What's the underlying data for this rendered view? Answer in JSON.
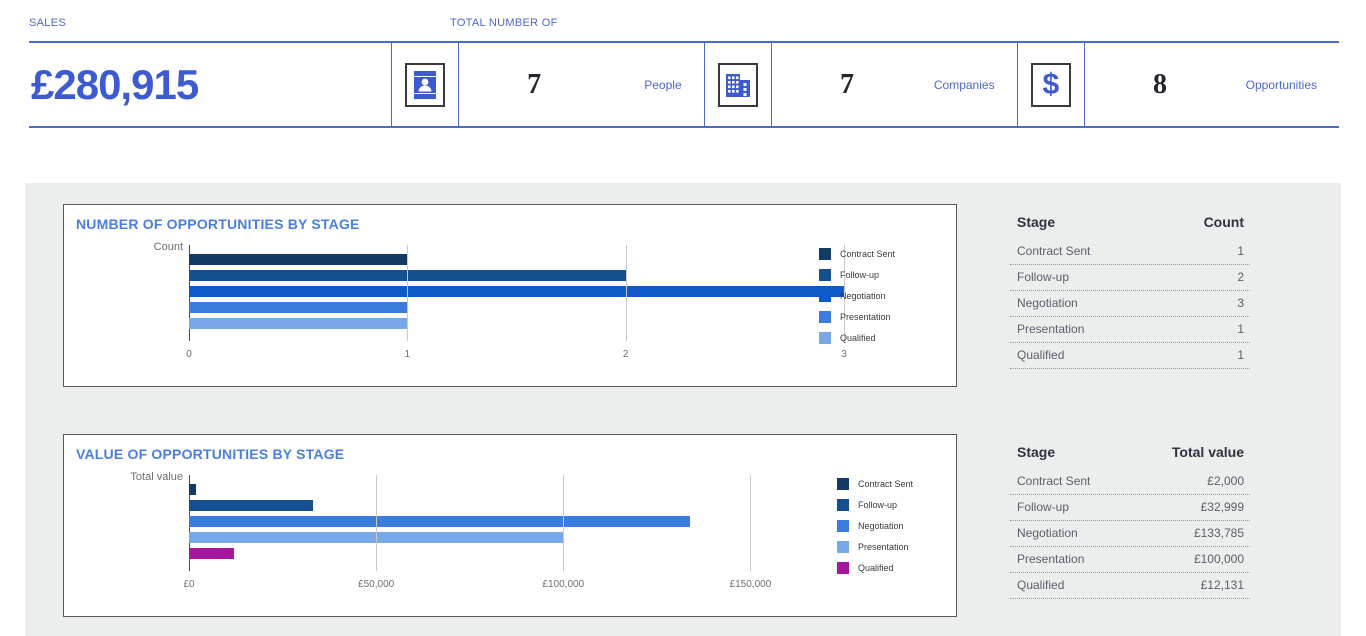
{
  "header": {
    "sales_caption": "SALES",
    "total_number_caption": "TOTAL NUMBER OF",
    "sales_value": "£280,915",
    "accent_color": "#3d5ad0",
    "caption_color": "#4d68c9",
    "metrics": [
      {
        "icon": "contact-card-icon",
        "value": "7",
        "label": "People"
      },
      {
        "icon": "building-icon",
        "value": "7",
        "label": "Companies"
      },
      {
        "icon": "dollar-icon",
        "value": "8",
        "label": "Opportunities"
      }
    ]
  },
  "charts": [
    {
      "title": "NUMBER OF OPPORTUNITIES BY STAGE",
      "axis_label": "Count",
      "table": {
        "col_stage": "Stage",
        "col_value": "Count"
      }
    },
    {
      "title": "VALUE OF OPPORTUNITIES BY STAGE",
      "axis_label": "Total value",
      "table": {
        "col_stage": "Stage",
        "col_value": "Total value"
      }
    }
  ],
  "chart_data": [
    {
      "type": "bar",
      "orientation": "horizontal",
      "title": "NUMBER OF OPPORTUNITIES BY STAGE",
      "xlabel": "",
      "ylabel": "Count",
      "categories": [
        "Contract Sent",
        "Follow-up",
        "Negotiation",
        "Presentation",
        "Qualified"
      ],
      "values": [
        1,
        2,
        3,
        1,
        1
      ],
      "value_labels": [
        "1",
        "2",
        "3",
        "1",
        "1"
      ],
      "colors": [
        "#113a64",
        "#14508f",
        "#1059c9",
        "#3b7ddd",
        "#78a7ea"
      ],
      "xlim": [
        0,
        3
      ],
      "xticks": [
        0,
        1,
        2,
        3
      ],
      "xticklabels": [
        "0",
        "1",
        "2",
        "3"
      ],
      "grid": true,
      "legend": [
        "Contract Sent",
        "Follow-up",
        "Negotiation",
        "Presentation",
        "Qualified"
      ],
      "legend_position": "right"
    },
    {
      "type": "bar",
      "orientation": "horizontal",
      "title": "VALUE OF OPPORTUNITIES BY STAGE",
      "xlabel": "",
      "ylabel": "Total value",
      "categories": [
        "Contract Sent",
        "Follow-up",
        "Negotiation",
        "Presentation",
        "Qualified"
      ],
      "values": [
        2000,
        32999,
        133785,
        100000,
        12131
      ],
      "value_labels": [
        "£2,000",
        "£32,999",
        "£133,785",
        "£100,000",
        "£12,131"
      ],
      "colors": [
        "#113a64",
        "#14508f",
        "#3b7ddd",
        "#78a7ea",
        "#a5169c"
      ],
      "xlim": [
        0,
        175000
      ],
      "xticks": [
        0,
        50000,
        100000,
        150000
      ],
      "xticklabels": [
        "£0",
        "£50,000",
        "£100,000",
        "£150,000"
      ],
      "grid": true,
      "legend": [
        "Contract Sent",
        "Follow-up",
        "Negotiation",
        "Presentation",
        "Qualified"
      ],
      "legend_position": "right"
    }
  ],
  "tables": [
    {
      "col_stage": "Stage",
      "col_value": "Count",
      "rows": [
        {
          "stage": "Contract Sent",
          "value": "1"
        },
        {
          "stage": "Follow-up",
          "value": "2"
        },
        {
          "stage": "Negotiation",
          "value": "3"
        },
        {
          "stage": "Presentation",
          "value": "1"
        },
        {
          "stage": "Qualified",
          "value": "1"
        }
      ]
    },
    {
      "col_stage": "Stage",
      "col_value": "Total value",
      "rows": [
        {
          "stage": "Contract Sent",
          "value": "£2,000"
        },
        {
          "stage": "Follow-up",
          "value": "£32,999"
        },
        {
          "stage": "Negotiation",
          "value": "£133,785"
        },
        {
          "stage": "Presentation",
          "value": "£100,000"
        },
        {
          "stage": "Qualified",
          "value": "£12,131"
        }
      ]
    }
  ]
}
